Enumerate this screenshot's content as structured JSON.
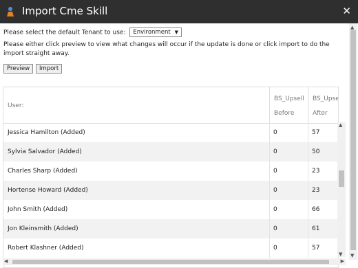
{
  "window": {
    "title": "Import Cme Skill",
    "close_label": "✕",
    "icon": "app-icon"
  },
  "tenant": {
    "prompt": "Please select the default Tenant to use:",
    "selected": "Environment"
  },
  "description": "Please either click preview to view what changes will occur if the update is done or click import to do the import straight away.",
  "buttons": {
    "preview": "Preview",
    "import": "Import"
  },
  "grid": {
    "columns": [
      {
        "line1": "User:",
        "line2": ""
      },
      {
        "line1": "BS_Upsell",
        "line2": "Before"
      },
      {
        "line1": "BS_Upse",
        "line2": "After"
      }
    ],
    "rows": [
      {
        "user": "Jessica Hamilton (Added)",
        "before": "0",
        "after": "57"
      },
      {
        "user": "Sylvia Salvador (Added)",
        "before": "0",
        "after": "50"
      },
      {
        "user": "Charles Sharp (Added)",
        "before": "0",
        "after": "23"
      },
      {
        "user": "Hortense Howard (Added)",
        "before": "0",
        "after": "23"
      },
      {
        "user": "John Smith (Added)",
        "before": "0",
        "after": "66"
      },
      {
        "user": "Jon Kleinsmith (Added)",
        "before": "0",
        "after": "61"
      },
      {
        "user": "Robert Klashner (Added)",
        "before": "0",
        "after": "57"
      }
    ]
  }
}
